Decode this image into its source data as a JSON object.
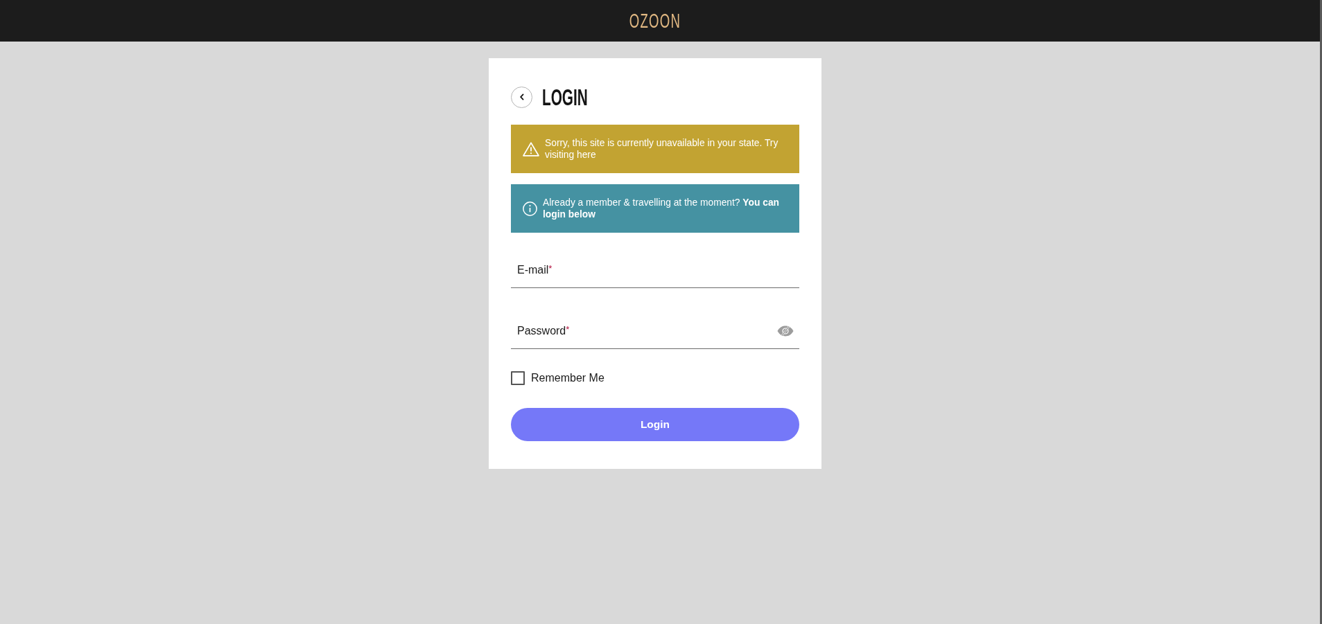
{
  "header": {
    "logo": "OZOON"
  },
  "login_card": {
    "title": "LOGIN",
    "alerts": [
      {
        "kind": "warning",
        "text": "Sorry, this site is currently unavailable in your state. Try visiting here"
      },
      {
        "kind": "info",
        "text": "Already a member & travelling at the moment? **You can login below**"
      }
    ],
    "fields": [
      {
        "kind": "email",
        "label": "E-mail",
        "required_mark": "*"
      },
      {
        "kind": "password",
        "label": "Password",
        "required_mark": "*"
      }
    ],
    "remember": {
      "label": "Remember Me",
      "checked": false
    },
    "submit": {
      "label": "Login"
    }
  }
}
